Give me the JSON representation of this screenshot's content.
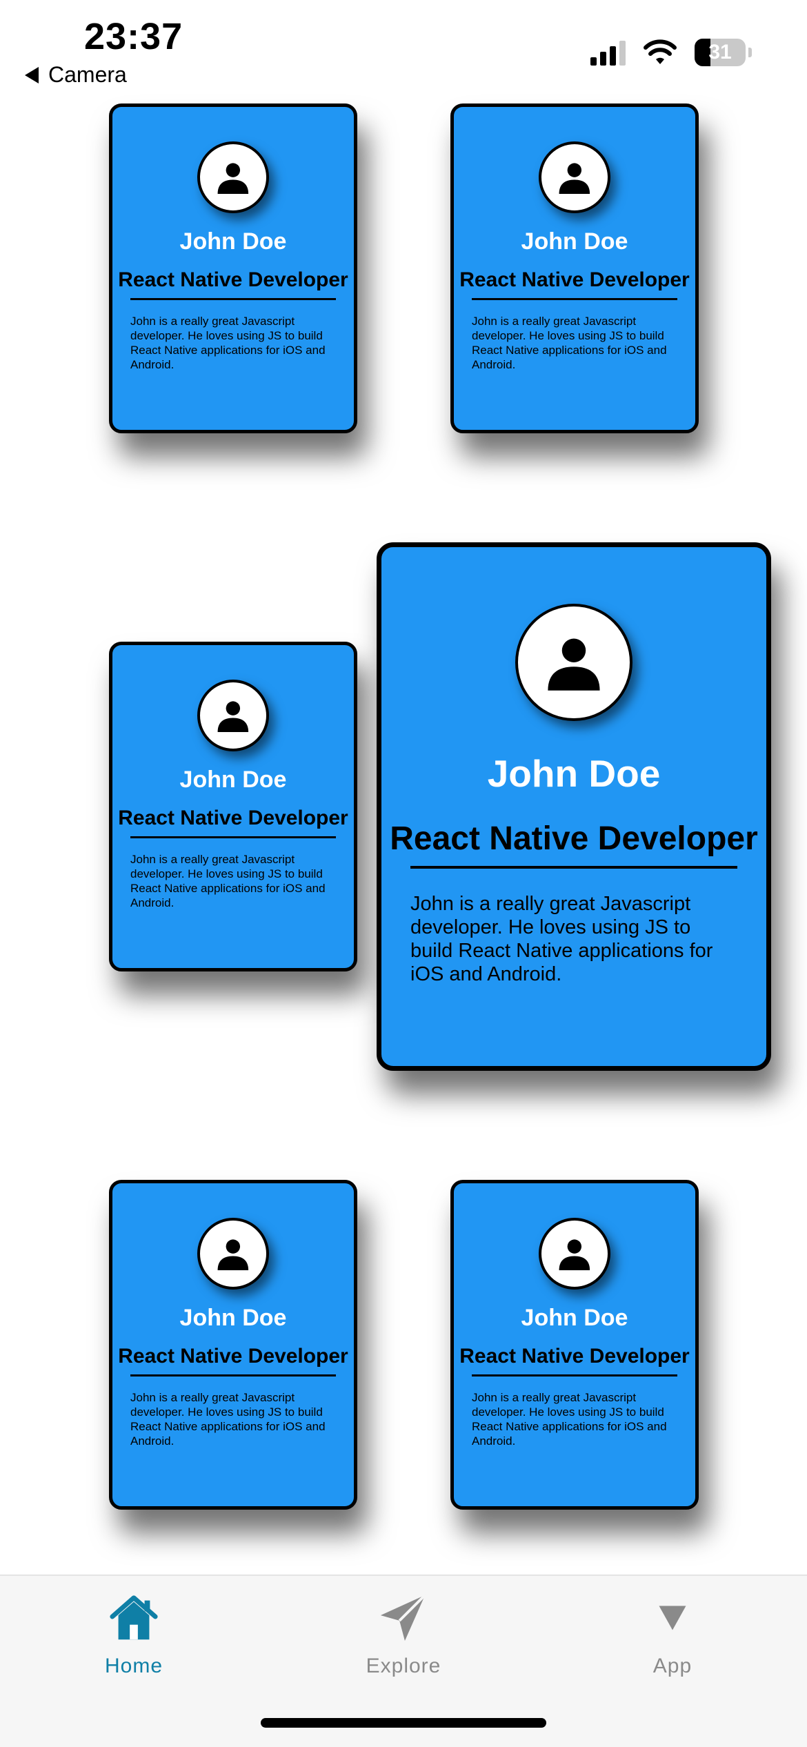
{
  "status_bar": {
    "time": "23:37",
    "back_label": "Camera",
    "battery_percent": "31",
    "battery_level": 0.31
  },
  "cards": [
    {
      "name": "John Doe",
      "role": "React Native Developer",
      "description": "John is a really great Javascript developer. He loves using JS to build React Native applications for iOS and Android."
    },
    {
      "name": "John Doe",
      "role": "React Native Developer",
      "description": "John is a really great Javascript developer. He loves using JS to build React Native applications for iOS and Android."
    },
    {
      "name": "John Doe",
      "role": "React Native Developer",
      "description": "John is a really great Javascript developer. He loves using JS to build React Native applications for iOS and Android."
    },
    {
      "name": "John Doe",
      "role": "React Native Developer",
      "description": "John is a really great Javascript developer. He loves using JS to build React Native applications for iOS and Android."
    },
    {
      "name": "John Doe",
      "role": "React Native Developer",
      "description": "John is a really great Javascript developer. He loves using JS to build React Native applications for iOS and Android."
    },
    {
      "name": "John Doe",
      "role": "React Native Developer",
      "description": "John is a really great Javascript developer. He loves using JS to build React Native applications for iOS and Android."
    }
  ],
  "tab_bar": {
    "tabs": [
      {
        "label": "Home",
        "icon": "home-icon",
        "active": true
      },
      {
        "label": "Explore",
        "icon": "paper-plane-icon",
        "active": false
      },
      {
        "label": "App",
        "icon": "triangle-down-icon",
        "active": false
      }
    ]
  },
  "colors": {
    "card_background": "#2196f3",
    "active_tab": "#0f7fa6",
    "inactive_tab": "#8a8a8a"
  }
}
